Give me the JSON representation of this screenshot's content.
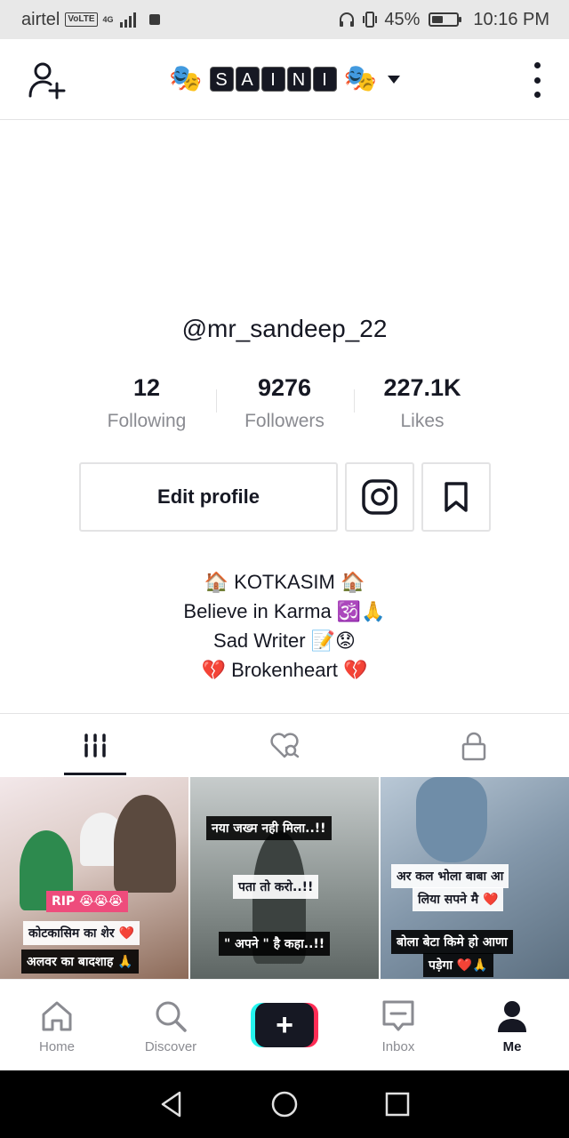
{
  "status_bar": {
    "carrier": "airtel",
    "volte": "VoLTE",
    "network": "4G",
    "battery": "45%",
    "battery_level": 0.45,
    "time": "10:16 PM"
  },
  "header": {
    "mask_left": "🎭",
    "letters": [
      "S",
      "A",
      "I",
      "N",
      "I"
    ],
    "mask_right": "🎭"
  },
  "profile": {
    "handle": "@mr_sandeep_22",
    "stats": [
      {
        "value": "12",
        "label": "Following"
      },
      {
        "value": "9276",
        "label": "Followers"
      },
      {
        "value": "227.1K",
        "label": "Likes"
      }
    ],
    "edit_label": "Edit profile",
    "bio": [
      "🏠 KOTKASIM 🏠",
      "Believe in Karma 🕉️🙏",
      "Sad Writer 📝😟",
      "💔 Brokenheart 💔"
    ]
  },
  "grid": {
    "video1": {
      "rip": "RIP 😭😭😭",
      "line1": "कोटकासिम का शेर ❤️",
      "line2": "अलवर का बादशाह 🙏"
    },
    "video2": {
      "line1": "नया जख्म नही मिला..!!",
      "line2": "पता तो करो..!!",
      "line3": "\" अपने \" है कहा..!!"
    },
    "video3": {
      "line1": "अर कल भोला बाबा आ",
      "line2": "लिया सपने मै ❤️",
      "line3": "बोला बेटा किमे हो आणा",
      "line4": "पड़ेगा ❤️🙏"
    }
  },
  "bottom_nav": {
    "home": "Home",
    "discover": "Discover",
    "create": "+",
    "inbox": "Inbox",
    "me": "Me"
  },
  "colors": {
    "text": "#161823",
    "muted": "#8a8b91",
    "border": "#e3e3e4",
    "accent_red": "#fe2c55",
    "accent_cyan": "#25f4ee"
  }
}
